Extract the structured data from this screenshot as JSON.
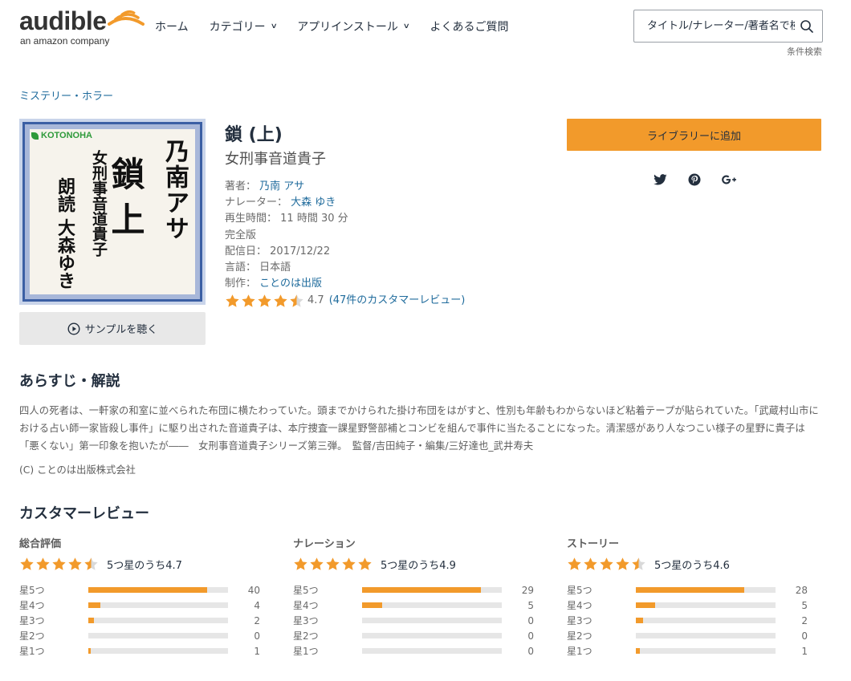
{
  "header": {
    "logo_text": "audible",
    "logo_sub": "an amazon company",
    "nav": [
      {
        "label": "ホーム",
        "has_dropdown": false
      },
      {
        "label": "カテゴリー",
        "has_dropdown": true
      },
      {
        "label": "アプリインストール",
        "has_dropdown": true
      },
      {
        "label": "よくあるご質問",
        "has_dropdown": false
      }
    ],
    "search_placeholder": "タイトル/ナレーター/著者名で検索",
    "advanced_search": "条件検索"
  },
  "breadcrumb": "ミステリー・ホラー",
  "cover": {
    "publisher_logo": "KOTONOHA",
    "author": "乃南アサ",
    "title": "鎖 上",
    "subtitle": "女刑事音道貴子",
    "narrator": "朗読 大森ゆき"
  },
  "sample_button": "サンプルを聴く",
  "book": {
    "title": "鎖 (上)",
    "subtitle": "女刑事音道貴子",
    "author_label": "著者：",
    "author": "乃南 アサ",
    "narrator_label": "ナレーター：",
    "narrator": "大森 ゆき",
    "length_label": "再生時間：",
    "length": "11 時間 30 分",
    "version": "完全版",
    "release_label": "配信日：",
    "release_date": "2017/12/22",
    "language_label": "言語：",
    "language": "日本語",
    "publisher_label": "制作：",
    "publisher": "ことのは出版",
    "rating": "4.7",
    "rating_value": 4.7,
    "reviews_link": "(47件のカスタマーレビュー)"
  },
  "actions": {
    "add_to_library": "ライブラリーに追加",
    "share_icons": [
      "twitter-icon",
      "pinterest-icon",
      "google-plus-icon"
    ]
  },
  "summary": {
    "heading": "あらすじ・解説",
    "text": "四人の死者は、一軒家の和室に並べられた布団に横たわっていた。頭までかけられた掛け布団をはがすと、性別も年齢もわからないほど粘着テープが貼られていた。「武蔵村山市における占い師一家皆殺し事件」に駆り出された音道貴子は、本庁捜査一課星野警部補とコンビを組んで事件に当たることになった。清潔感があり人なつこい様子の星野に貴子は「悪くない」第一印象を抱いたが――　女刑事音道貴子シリーズ第三弾。　監督/吉田純子・編集/三好達也_武井寿夫",
    "copyright": "(C) ことのは出版株式会社"
  },
  "reviews": {
    "heading": "カスタマーレビュー",
    "columns": [
      {
        "title": "総合評価",
        "score_text": "5つ星のうち4.7",
        "score": 4.7,
        "rows": [
          {
            "label": "星5つ",
            "count": "40",
            "fraction": 0.85
          },
          {
            "label": "星4つ",
            "count": "4",
            "fraction": 0.085
          },
          {
            "label": "星3つ",
            "count": "2",
            "fraction": 0.043
          },
          {
            "label": "星2つ",
            "count": "0",
            "fraction": 0
          },
          {
            "label": "星1つ",
            "count": "1",
            "fraction": 0.021
          }
        ]
      },
      {
        "title": "ナレーション",
        "score_text": "5つ星のうち4.9",
        "score": 4.9,
        "rows": [
          {
            "label": "星5つ",
            "count": "29",
            "fraction": 0.85
          },
          {
            "label": "星4つ",
            "count": "5",
            "fraction": 0.147
          },
          {
            "label": "星3つ",
            "count": "0",
            "fraction": 0
          },
          {
            "label": "星2つ",
            "count": "0",
            "fraction": 0
          },
          {
            "label": "星1つ",
            "count": "0",
            "fraction": 0
          }
        ]
      },
      {
        "title": "ストーリー",
        "score_text": "5つ星のうち4.6",
        "score": 4.6,
        "rows": [
          {
            "label": "星5つ",
            "count": "28",
            "fraction": 0.778
          },
          {
            "label": "星4つ",
            "count": "5",
            "fraction": 0.139
          },
          {
            "label": "星3つ",
            "count": "2",
            "fraction": 0.056
          },
          {
            "label": "星2つ",
            "count": "0",
            "fraction": 0
          },
          {
            "label": "星1つ",
            "count": "1",
            "fraction": 0.028
          }
        ]
      }
    ]
  },
  "colors": {
    "accent": "#f29a2b",
    "link": "#1f6b9c",
    "text": "#232f3e"
  }
}
